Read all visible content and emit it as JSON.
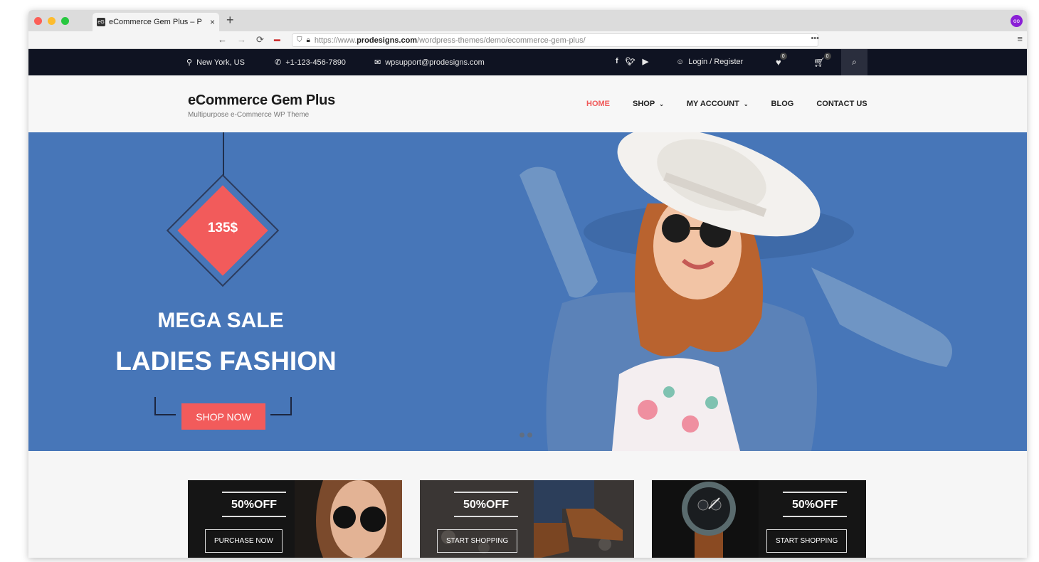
{
  "browser": {
    "tab_title": "eCommerce Gem Plus – P",
    "tab_favicon": "eG",
    "tab_close": "×",
    "new_tab": "+",
    "url_prefix": "https://www.",
    "url_host": "prodesigns.com",
    "url_path": "/wordpress-themes/demo/ecommerce-gem-plus/",
    "overflow": "•••",
    "menu": "≡",
    "ext_icon": "oo"
  },
  "topbar": {
    "location": "New York, US",
    "phone": "+1-123-456-7890",
    "email": "wpsupport@prodesigns.com",
    "login": "Login / Register",
    "wishlist_count": "0",
    "cart_count": "0"
  },
  "site": {
    "title": "eCommerce Gem Plus",
    "tagline": "Multipurpose e-Commerce WP Theme"
  },
  "menu": {
    "home": "HOME",
    "shop": "SHOP",
    "account": "MY ACCOUNT",
    "blog": "BLOG",
    "contact": "CONTACT US"
  },
  "hero": {
    "price": "135$",
    "line1": "MEGA SALE",
    "line2": "LADIES FASHION",
    "cta": "SHOP NOW"
  },
  "promos": [
    {
      "discount": "50%OFF",
      "button": "PURCHASE NOW"
    },
    {
      "discount": "50%OFF",
      "button": "START SHOPPING"
    },
    {
      "discount": "50%OFF",
      "button": "START SHOPPING"
    }
  ],
  "colors": {
    "accent": "#f25b5b",
    "hero_bg": "#4776b8",
    "topbar_bg": "#0f1322"
  },
  "icons": {
    "location": "map-marker-icon",
    "phone": "phone-icon",
    "email": "envelope-icon",
    "facebook": "facebook-icon",
    "twitter": "twitter-icon",
    "youtube": "youtube-icon",
    "user": "user-icon",
    "heart": "heart-icon",
    "cart": "cart-icon",
    "search": "search-icon"
  }
}
